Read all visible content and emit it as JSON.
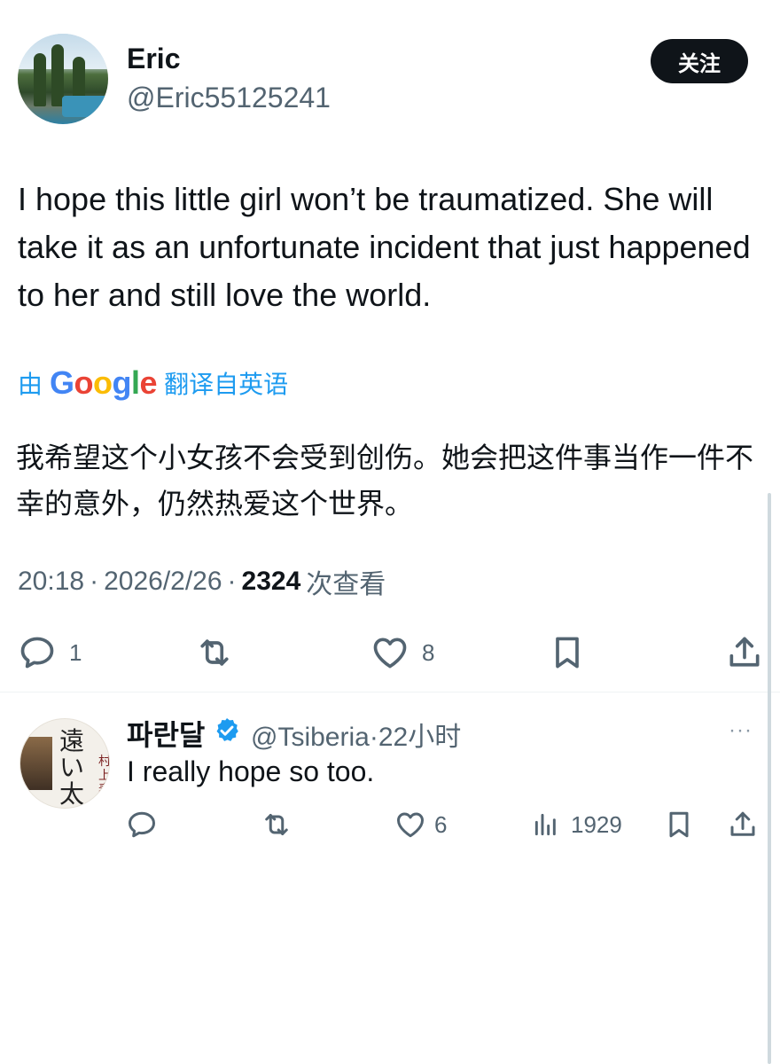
{
  "tweet": {
    "author_name": "Eric",
    "author_handle": "@Eric55125241",
    "follow_label": "关注",
    "text": "I hope this little girl won’t be traumatized. She will take it as an unfortunate incident that just happened to her and still love the world.",
    "translate_prefix": "由",
    "google_letters": [
      "G",
      "o",
      "o",
      "g",
      "l",
      "e"
    ],
    "translate_suffix": "翻译自英语",
    "translated_text": "我希望这个小女孩不会受到创伤。她会把这件事当作一件不幸的意外，仍然热爱这个世界。",
    "time": "20:18",
    "date": "2026/2/26",
    "views": "2324",
    "views_label": "次查看",
    "actions": {
      "reply_count": "1",
      "retweet_count": "",
      "like_count": "8"
    }
  },
  "reply": {
    "author_name": "파란달",
    "author_handle": "@Tsiberia",
    "time_ago": "22小时",
    "text": "I really hope so too.",
    "more_label": "···",
    "actions": {
      "like_count": "6",
      "views_count": "1929"
    },
    "avatar_text_main": "遠い太鼓",
    "avatar_text_side": "村上春樹"
  },
  "colors": {
    "primary_text": "#0f1419",
    "secondary_text": "#536471",
    "link_blue": "#1d9bf0",
    "verified_blue": "#1d9bf0",
    "google_blue": "#4285f4",
    "google_red": "#ea4335",
    "google_yellow": "#fbbc05",
    "google_green": "#34a853"
  }
}
